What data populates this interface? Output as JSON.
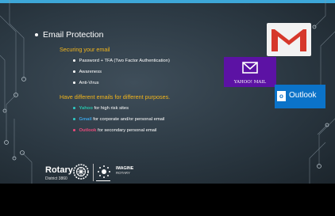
{
  "slide": {
    "heading": "Email Protection",
    "sections": [
      {
        "title": "Securing your email",
        "items": [
          "Password + TFA (Two Factor Authentication)",
          "Awareness",
          "Anti-Virus"
        ]
      },
      {
        "title": "Have different emails for different purposes.",
        "items": [
          {
            "brand": "Yahoo",
            "rest": " for high risk sites"
          },
          {
            "brand": "Gmail",
            "rest": " for corporate and/or personal email"
          },
          {
            "brand": "Outlook",
            "rest": " for secondary personal email"
          }
        ]
      }
    ],
    "logos": {
      "yahoo_text": "YAHOO! MAIL",
      "outlook_text": "Outlook",
      "outlook_badge": "o"
    },
    "footer": {
      "rotary": "Rotary",
      "district": "District 3860",
      "imagine": "IMAGINE",
      "imagine_sub": "ROTARY"
    }
  },
  "colors": {
    "accent_top": "#3da7d8",
    "subheading": "#f2b51c",
    "yahoo": "#28c0a8",
    "gmail": "#3a9fe0",
    "outlook": "#e84b7a"
  }
}
